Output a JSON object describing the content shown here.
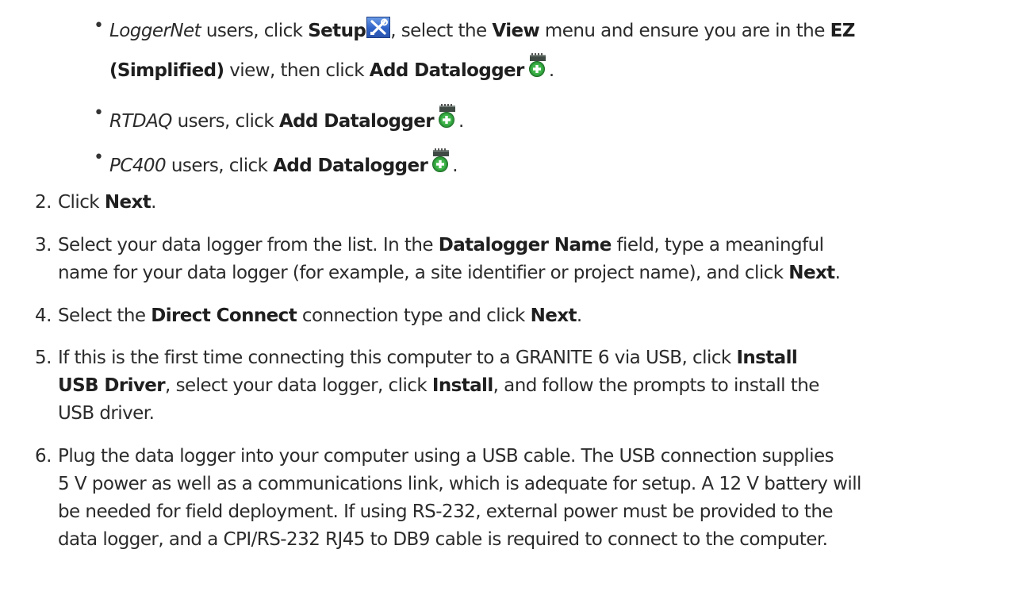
{
  "bullets": [
    {
      "l1_prefix": "LoggerNet",
      "l1_a": " users, click ",
      "l1_b": "Setup",
      "l1_c": ", select the ",
      "l1_d": "View",
      "l1_e": " menu and ensure you are in the ",
      "l1_f": "EZ",
      "l2_a": "(Simplified)",
      "l2_b": " view, then click ",
      "l2_c": "Add Datalogger",
      "l2_d": "."
    },
    {
      "prefix": "RTDAQ",
      "a": " users, click ",
      "b": "Add Datalogger",
      "c": "."
    },
    {
      "prefix": "PC400",
      "a": " users, click ",
      "b": "Add Datalogger",
      "c": "."
    }
  ],
  "icons": {
    "setup": "setup-tools-icon",
    "add": "add-datalogger-icon"
  },
  "steps": [
    {
      "num": "2.",
      "a": "Click ",
      "b": "Next",
      "c": "."
    },
    {
      "num": "3.",
      "l1_a": "Select your data logger from the list. In the ",
      "l1_b": "Datalogger Name",
      "l1_c": " field, type a meaningful",
      "l2_a": "name for your data logger (for example, a site identifier or project name), and click ",
      "l2_b": "Next",
      "l2_c": "."
    },
    {
      "num": "4.",
      "a": "Select the ",
      "b": "Direct Connect",
      "c": " connection type and click ",
      "d": "Next",
      "e": "."
    },
    {
      "num": "5.",
      "l1_a": "If this is the first time connecting this computer to a GRANITE 6 via USB, click ",
      "l1_b": "Install",
      "l2_a": "USB Driver",
      "l2_b": ", select your data logger, click ",
      "l2_c": "Install",
      "l2_d": ", and follow the prompts to install the",
      "l3": "USB driver."
    },
    {
      "num": "6.",
      "l1": "Plug the data logger into your computer using a USB  cable. The USB connection supplies",
      "l2": "5 V power as well as a communications link, which is adequate for setup. A 12 V battery will",
      "l3": "be needed for field deployment. If using RS-232, external power must be provided to the",
      "l4": "data logger, and a CPI/RS-232 RJ45 to DB9 cable is required to connect to the computer."
    }
  ]
}
